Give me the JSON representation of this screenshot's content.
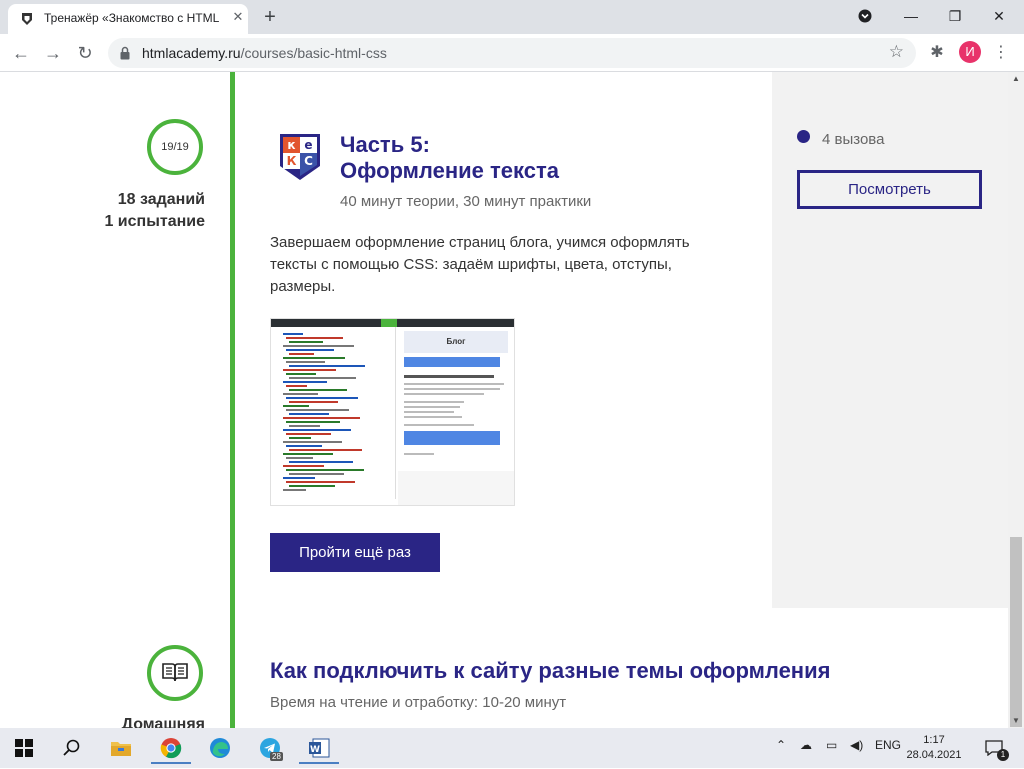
{
  "browser": {
    "tab_title": "Тренажёр «Знакомство с HTML",
    "url_host": "htmlacademy.ru",
    "url_path": "/courses/basic-html-css",
    "profile_initial": "И"
  },
  "course": {
    "progress": "19/19",
    "stats_line1": "18 заданий",
    "stats_line2": "1 испытание",
    "logo_letters": [
      "к",
      "е",
      "К",
      "С"
    ],
    "title_line1": "Часть 5:",
    "title_line2": "Оформление текста",
    "meta": "40 минут теории, 30 минут практики",
    "description": "Завершаем оформление страниц блога, учимся оформлять тексты с помощью CSS: задаём шрифты, цвета, отступы, размеры.",
    "preview_header": "Блог",
    "retry_button": "Пройти ещё раз",
    "challenges": "4 вызова",
    "view_button": "Посмотреть"
  },
  "next_section": {
    "title": "Как подключить к сайту разные темы оформления",
    "meta": "Время на чтение и отработку: 10-20 минут",
    "label": "Домашняя"
  },
  "taskbar": {
    "language": "ENG",
    "time": "1:17",
    "date": "28.04.2021",
    "notification_count": "1",
    "telegram_badge": "28"
  },
  "colors": {
    "brand": "#2a2585",
    "timeline": "#4bb33c",
    "panel": "#f2f2f2"
  }
}
